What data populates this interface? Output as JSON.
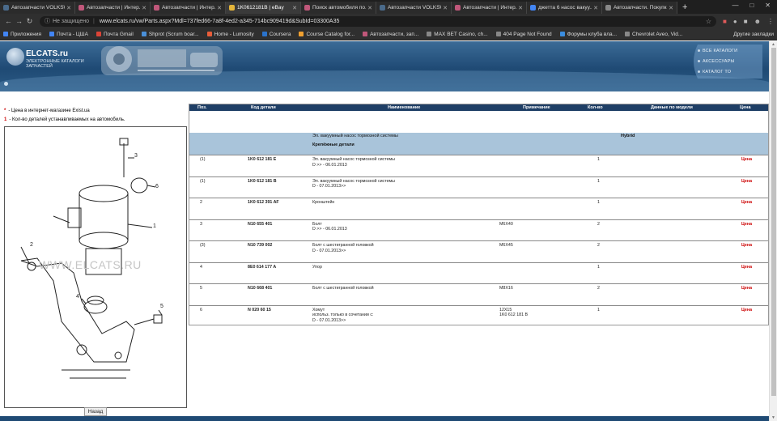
{
  "browser": {
    "tabs": [
      {
        "title": "Автозапчасти VOLKSW...",
        "color": "#4a6a8a"
      },
      {
        "title": "Автозапчасти | Интер...",
        "color": "#c0577a"
      },
      {
        "title": "Автозапчасти | Интер...",
        "color": "#c0577a"
      },
      {
        "title": "1K0612181B | eBay",
        "color": "#e4b53a"
      },
      {
        "title": "Поиск автомобиля по...",
        "color": "#c0577a"
      },
      {
        "title": "Автозапчасти VOLKSW...",
        "color": "#4a6a8a"
      },
      {
        "title": "Автозапчасти | Интер...",
        "color": "#c0577a"
      },
      {
        "title": "джетта 6 насос вакуу...",
        "color": "#4285f4"
      },
      {
        "title": "Автозапчасти. Покупк...",
        "color": "#888888"
      }
    ],
    "new_tab": "+",
    "security_label": "Не защищено",
    "url": "www.elcats.ru/vw/Parts.aspx?Mdl=737fed66-7a8f-4ed2-a345-714bc909419d&SubId=03300A35",
    "bookmarks": [
      {
        "label": "Приложения",
        "color": "#4285f4"
      },
      {
        "label": "Почта - ЦША",
        "color": "#4285f4"
      },
      {
        "label": "Почта Gmail",
        "color": "#db4437"
      },
      {
        "label": "Shprot (Scrum boar...",
        "color": "#4a90d9"
      },
      {
        "label": "Home - Lumosity",
        "color": "#e85d3a"
      },
      {
        "label": "Coursera",
        "color": "#2a73cc"
      },
      {
        "label": "Course Catalog for...",
        "color": "#f0a030"
      },
      {
        "label": "Автозапчасти, зап...",
        "color": "#c0577a"
      },
      {
        "label": "MAX BET Casino, ch...",
        "color": "#888888"
      },
      {
        "label": "404 Page Not Found",
        "color": "#888888"
      },
      {
        "label": "Форумы клуба вла...",
        "color": "#3b8de0"
      },
      {
        "label": "Chevrolet Aveo, Vid...",
        "color": "#888888"
      }
    ],
    "other_bookmarks": "Другие закладки"
  },
  "site": {
    "logo_text": "ELCATS.ru",
    "logo_sub": "Электронные каталоги запчастей",
    "menu": [
      "Все каталоги",
      "Аксессуары",
      "Каталог ТО"
    ]
  },
  "legend": {
    "price_mark": "*",
    "price_text": "- Цена в интернет-магазине Exist.ua",
    "qty_mark": "1",
    "qty_text": "- Кол-во деталей устанавливаемых на автомобиль."
  },
  "diagram": {
    "watermark": "WWW.ELCATS.RU",
    "callouts": [
      "1",
      "2",
      "3",
      "4",
      "5",
      "6"
    ],
    "back_button": "Назад"
  },
  "table": {
    "headers": {
      "pos": "Поз.",
      "code": "Код детали",
      "name": "Наименование",
      "note": "Примечание",
      "qty": "Кол-во",
      "model": "Данные по модели",
      "price": "Цена"
    },
    "group": {
      "title": "Эл. вакуумный насос тормозной системы",
      "subtitle": "Крепёжные детали",
      "model": "Hybrid"
    },
    "rows": [
      {
        "pos": "(1)",
        "code": "1K0 612 181 E",
        "name": "Эл. вакуумный насос тормозной системы",
        "name2": "D >> - 06.01.2013",
        "note": "",
        "note2": "",
        "qty": "1",
        "price": "Цена"
      },
      {
        "pos": "(1)",
        "code": "1K0 612 181 B",
        "name": "Эл. вакуумный насос тормозной системы",
        "name2": "D - 07.01.2013>>",
        "note": "",
        "note2": "",
        "qty": "1",
        "price": "Цена"
      },
      {
        "pos": "2",
        "code": "1K0 612 391 AF",
        "name": "Кронштейн",
        "name2": "",
        "note": "",
        "note2": "",
        "qty": "1",
        "price": "Цена"
      },
      {
        "pos": "3",
        "code": "N10 655 401",
        "name": "Болт",
        "name2": "D >> - 06.01.2013",
        "note": "M6X40",
        "note2": "",
        "qty": "2",
        "price": "Цена"
      },
      {
        "pos": "(3)",
        "code": "N10 739 002",
        "name": "Болт с шестигранной головкой",
        "name2": "D - 07.01.2013>>",
        "note": "M6X45",
        "note2": "",
        "qty": "2",
        "price": "Цена"
      },
      {
        "pos": "4",
        "code": "8E0 614 177 A",
        "name": "Упор",
        "name2": "",
        "note": "",
        "note2": "",
        "qty": "1",
        "price": "Цена"
      },
      {
        "pos": "5",
        "code": "N10 668 401",
        "name": "Болт с шестигранной головкой",
        "name2": "",
        "note": "M8X16",
        "note2": "",
        "qty": "2",
        "price": "Цена"
      },
      {
        "pos": "6",
        "code": "N 020 60 15",
        "name": "Хомут",
        "name2": "использ. только в сочетании с:",
        "name3": "D - 07.01.2013>>",
        "note": "12X15",
        "note2": "1K0 612 181 B",
        "qty": "1",
        "price": "Цена"
      }
    ]
  }
}
